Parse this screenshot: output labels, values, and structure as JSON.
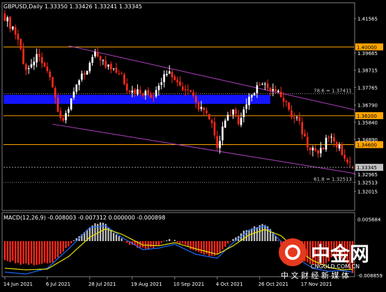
{
  "header": {
    "symbol_info": "GBPUSD,Daily  1.33350 1.33426 1.33241 1.33345"
  },
  "colors": {
    "background": "#000000",
    "frame": "#7f7f7f",
    "text": "#ffffff",
    "bull": "#ffffff",
    "bear": "#ff2a1a",
    "channel": "#b040c0",
    "level": "#ffa500",
    "zone": "#1414ff",
    "macd_hist_pos": "#c0c0c0",
    "macd_hist_neg": "#ff2a1a",
    "macd_main": "#1e6bff",
    "macd_signal": "#e6e600",
    "current_price_tag": "#c0c0c0",
    "watermark_red": "#e53a1e",
    "watermark_text": "#ffffff"
  },
  "chart_data": [
    {
      "type": "candlestick",
      "title": "GBPUSD,Daily",
      "ohlc_readout": {
        "open": 1.3335,
        "high": 1.33426,
        "low": 1.33241,
        "close": 1.33345
      },
      "ylim": [
        1.31,
        1.424
      ],
      "y_tick_labels": [
        "1.41565",
        "1.40000",
        "1.39665",
        "1.38715",
        "1.37765",
        "1.36790",
        "1.36200",
        "1.35840",
        "1.34890",
        "1.34600",
        "1.33345",
        "1.32965",
        "1.32513",
        "1.32015"
      ],
      "x_tick_labels": [
        "14 Jun 2021",
        "6 Jul 2021",
        "28 Jul 2021",
        "19 Aug 2021",
        "10 Sep 2021",
        "4 Oct 2021",
        "26 Oct 2021",
        "17 Nov 2021"
      ],
      "bar_count": 132,
      "first_bar_date": "14 Jun 2021",
      "horizontal_levels": [
        {
          "price": 1.4,
          "label": "1.40000"
        },
        {
          "price": 1.362,
          "label": "1.36200"
        },
        {
          "price": 1.346,
          "label": "1.34600"
        }
      ],
      "fib_levels": [
        {
          "price": 1.37411,
          "label": "78.6 = 1.37411"
        },
        {
          "price": 1.32513,
          "label": "61.8 = 1.32513"
        }
      ],
      "zone": {
        "from_price": 1.3685,
        "to_price": 1.3735
      },
      "current_price": {
        "price": 1.33345,
        "label": "1.33345"
      },
      "channel_upper": [
        {
          "bar": 24,
          "price": 1.4006
        },
        {
          "bar": 132,
          "price": 1.3652
        }
      ],
      "channel_lower": [
        {
          "bar": 18,
          "price": 1.3573
        },
        {
          "bar": 132,
          "price": 1.33
        }
      ],
      "price_path": [
        [
          0,
          1.4165
        ],
        [
          3,
          1.4098
        ],
        [
          6,
          1.3982
        ],
        [
          8,
          1.3862
        ],
        [
          10,
          1.3915
        ],
        [
          13,
          1.3958
        ],
        [
          15,
          1.3881
        ],
        [
          17,
          1.3812
        ],
        [
          19,
          1.3711
        ],
        [
          21,
          1.3614
        ],
        [
          22,
          1.3588
        ],
        [
          24,
          1.3672
        ],
        [
          26,
          1.3756
        ],
        [
          28,
          1.3802
        ],
        [
          30,
          1.3865
        ],
        [
          32,
          1.3901
        ],
        [
          34,
          1.3985
        ],
        [
          36,
          1.3935
        ],
        [
          38,
          1.3895
        ],
        [
          40,
          1.3876
        ],
        [
          42,
          1.3858
        ],
        [
          44,
          1.3832
        ],
        [
          46,
          1.3779
        ],
        [
          48,
          1.3745
        ],
        [
          50,
          1.3762
        ],
        [
          52,
          1.3748
        ],
        [
          54,
          1.3735
        ],
        [
          56,
          1.3722
        ],
        [
          58,
          1.3775
        ],
        [
          60,
          1.3842
        ],
        [
          62,
          1.3868
        ],
        [
          64,
          1.3825
        ],
        [
          66,
          1.3784
        ],
        [
          68,
          1.3776
        ],
        [
          70,
          1.3742
        ],
        [
          72,
          1.3688
        ],
        [
          74,
          1.3652
        ],
        [
          76,
          1.3615
        ],
        [
          78,
          1.3588
        ],
        [
          79,
          1.3495
        ],
        [
          80,
          1.3452
        ],
        [
          82,
          1.3545
        ],
        [
          84,
          1.3612
        ],
        [
          86,
          1.3638
        ],
        [
          88,
          1.3589
        ],
        [
          90,
          1.3652
        ],
        [
          92,
          1.3716
        ],
        [
          94,
          1.3758
        ],
        [
          96,
          1.3806
        ],
        [
          98,
          1.3782
        ],
        [
          100,
          1.3752
        ],
        [
          102,
          1.3762
        ],
        [
          104,
          1.3726
        ],
        [
          106,
          1.3681
        ],
        [
          108,
          1.3612
        ],
        [
          110,
          1.3612
        ],
        [
          112,
          1.3538
        ],
        [
          114,
          1.3452
        ],
        [
          116,
          1.3428
        ],
        [
          118,
          1.3402
        ],
        [
          120,
          1.3452
        ],
        [
          122,
          1.3508
        ],
        [
          124,
          1.3481
        ],
        [
          126,
          1.3442
        ],
        [
          128,
          1.3392
        ],
        [
          130,
          1.3362
        ],
        [
          131,
          1.3335
        ]
      ]
    },
    {
      "type": "bar+line",
      "title": "MACD(12,26,9)",
      "readout": "MACD(12,26,9) -0.008003 -0.007312 0.000000 -0.000898",
      "ylim": [
        -0.009,
        0.0072
      ],
      "y_tick_labels": [
        "0.005684",
        "-0.008859"
      ],
      "histogram_path": [
        [
          0,
          -0.0048
        ],
        [
          6,
          -0.0058
        ],
        [
          12,
          -0.006
        ],
        [
          18,
          -0.0056
        ],
        [
          23,
          -0.002
        ],
        [
          26,
          0.0002
        ],
        [
          30,
          0.0026
        ],
        [
          34,
          0.0046
        ],
        [
          37,
          0.0048
        ],
        [
          41,
          0.0022
        ],
        [
          46,
          -0.0004
        ],
        [
          50,
          -0.0016
        ],
        [
          54,
          -0.002
        ],
        [
          58,
          -0.001
        ],
        [
          61,
          0.0004
        ],
        [
          64,
          0.0
        ],
        [
          68,
          -0.0012
        ],
        [
          73,
          -0.003
        ],
        [
          78,
          -0.004
        ],
        [
          82,
          -0.0024
        ],
        [
          86,
          0.0006
        ],
        [
          90,
          0.0026
        ],
        [
          94,
          0.0036
        ],
        [
          98,
          0.0044
        ],
        [
          101,
          0.0024
        ],
        [
          105,
          -0.0018
        ],
        [
          110,
          -0.0042
        ],
        [
          115,
          -0.006
        ],
        [
          120,
          -0.006
        ],
        [
          124,
          -0.004
        ],
        [
          128,
          -0.005
        ],
        [
          131,
          -0.008
        ]
      ],
      "signal_path": [
        [
          0,
          -0.007
        ],
        [
          8,
          -0.0074
        ],
        [
          16,
          -0.0072
        ],
        [
          24,
          -0.004
        ],
        [
          32,
          0.001
        ],
        [
          38,
          0.0032
        ],
        [
          44,
          0.0018
        ],
        [
          52,
          -0.001
        ],
        [
          58,
          -0.0012
        ],
        [
          64,
          -0.0004
        ],
        [
          72,
          -0.002
        ],
        [
          80,
          -0.0034
        ],
        [
          86,
          -0.0012
        ],
        [
          92,
          0.0016
        ],
        [
          98,
          0.003
        ],
        [
          104,
          0.0014
        ],
        [
          110,
          -0.0022
        ],
        [
          116,
          -0.005
        ],
        [
          122,
          -0.0068
        ],
        [
          127,
          -0.0074
        ],
        [
          131,
          -0.0073
        ]
      ],
      "main_line_path": [
        [
          0,
          -0.008
        ],
        [
          8,
          -0.0085
        ],
        [
          16,
          -0.007
        ],
        [
          24,
          -0.002
        ],
        [
          32,
          0.0035
        ],
        [
          38,
          0.004
        ],
        [
          44,
          0.001
        ],
        [
          52,
          -0.0022
        ],
        [
          58,
          -0.0018
        ],
        [
          64,
          -0.0008
        ],
        [
          72,
          -0.0034
        ],
        [
          80,
          -0.0044
        ],
        [
          86,
          -0.0004
        ],
        [
          92,
          0.0028
        ],
        [
          98,
          0.004
        ],
        [
          104,
          0.0
        ],
        [
          110,
          -0.0044
        ],
        [
          116,
          -0.007
        ],
        [
          122,
          -0.0078
        ],
        [
          127,
          -0.0076
        ],
        [
          131,
          -0.008
        ]
      ]
    }
  ],
  "watermark": {
    "brand": "中金网",
    "domain": "CNGOLD.COM.CN",
    "slogan": "中 文 财 经 新 媒 体"
  }
}
